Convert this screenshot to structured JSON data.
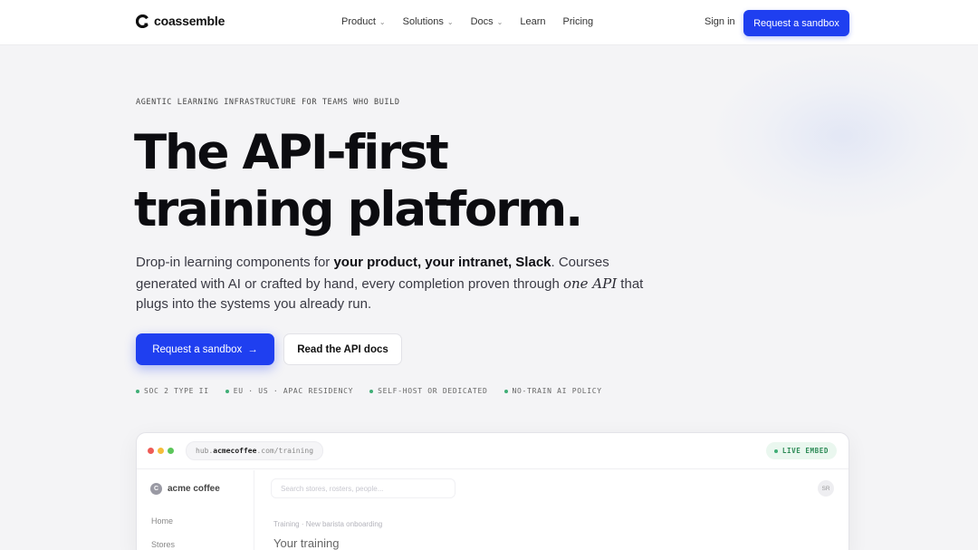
{
  "nav": {
    "logo_text": "coassemble",
    "links": [
      {
        "label": "Product",
        "has_menu": true
      },
      {
        "label": "Solutions",
        "has_menu": true
      },
      {
        "label": "Docs",
        "has_menu": true
      },
      {
        "label": "Learn",
        "has_menu": false
      },
      {
        "label": "Pricing",
        "has_menu": false
      }
    ],
    "signin": "Sign in",
    "cta": "Request a sandbox"
  },
  "hero": {
    "eyebrow": "AGENTIC LEARNING INFRASTRUCTURE FOR TEAMS WHO BUILD",
    "headline_line1": "The API-first",
    "headline_line2": "training platform.",
    "sub_part1": "Drop-in learning components for ",
    "sub_bold": "your product, your intranet, Slack",
    "sub_part2": ". Courses generated with AI or crafted by hand, every completion proven through ",
    "sub_italic": "one API",
    "sub_part3": " that plugs into the systems you already run.",
    "primary_button": "Request a sandbox",
    "primary_arrow": "→",
    "secondary_button": "Read the API docs",
    "badges": [
      "SOC 2 TYPE II",
      "EU · US · APAC RESIDENCY",
      "SELF-HOST OR DEDICATED",
      "NO-TRAIN AI POLICY"
    ]
  },
  "browser": {
    "url_prefix": "hub.",
    "url_host": "acmecoffee",
    "url_suffix": ".com/training",
    "live_badge": "LIVE EMBED",
    "org_initial": "C",
    "org_name": "acme coffee",
    "sidebar": [
      "Home",
      "Stores"
    ],
    "search_placeholder": "Search stores, rosters, people...",
    "user_initials": "SR",
    "breadcrumb": "Training · New barista onboarding",
    "page_title": "Your training"
  },
  "colors": {
    "accent": "#1f3ff0",
    "status_green": "#3fae76",
    "traffic_red": "#ee5b56",
    "traffic_yellow": "#f5bd3a",
    "traffic_green": "#5cc65a"
  },
  "icons": {
    "logo": "coassemble-logo-icon",
    "chevron": "chevron-down-icon",
    "arrow": "arrow-right-icon"
  }
}
